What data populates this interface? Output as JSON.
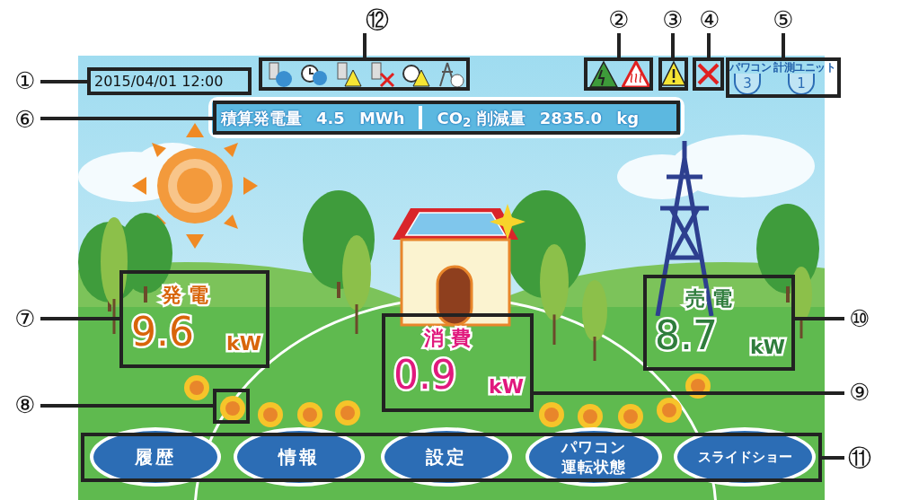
{
  "datetime": "2015/04/01 12:00",
  "counters": [
    {
      "label": "パワコン",
      "value": "3"
    },
    {
      "label": "計測ユニット",
      "value": "1"
    }
  ],
  "summary": {
    "generation_label": "積算発電量",
    "generation_value": "4.5",
    "generation_unit": "MWh",
    "co2_label": "CO$_{2}$ 削減量",
    "co2_value": "2835.0",
    "co2_unit": "kg"
  },
  "readouts": [
    {
      "label": "発電",
      "value": "9.6",
      "unit": "kW",
      "color": "#d8650a"
    },
    {
      "label": "消費",
      "value": "0.9",
      "unit": "kW",
      "color": "#e0197d"
    },
    {
      "label": "売電",
      "value": "8.7",
      "unit": "kW",
      "color": "#2f7d3c"
    }
  ],
  "buttons": [
    {
      "lines": [
        "履歴"
      ]
    },
    {
      "lines": [
        "情報"
      ]
    },
    {
      "lines": [
        "設定"
      ]
    },
    {
      "lines": [
        "パワコン",
        "運転状態"
      ]
    },
    {
      "lines": [
        "スライドショー"
      ]
    }
  ],
  "callouts": [
    "⑫",
    "②",
    "③",
    "④",
    "⑤",
    "①",
    "⑥",
    "⑦",
    "⑩",
    "⑨",
    "⑧",
    "⑪"
  ]
}
